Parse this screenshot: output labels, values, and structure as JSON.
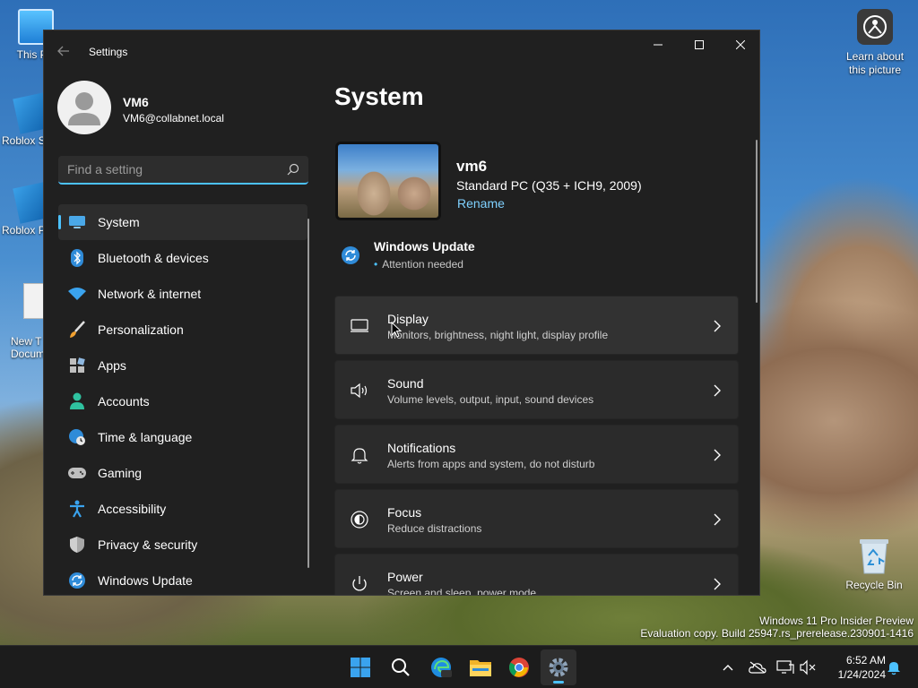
{
  "desktop": {
    "icons": [
      {
        "label": "This PC",
        "name": "this-pc"
      },
      {
        "label": "Roblox S",
        "name": "roblox-studio"
      },
      {
        "label": "Roblox P",
        "name": "roblox-player"
      },
      {
        "label": "New T\nDocum",
        "name": "new-text-document"
      }
    ],
    "learn_label": "Learn about this picture",
    "recycle_label": "Recycle Bin",
    "watermark_line1": "Windows 11 Pro Insider Preview",
    "watermark_line2": "Evaluation copy. Build 25947.rs_prerelease.230901-1416"
  },
  "window": {
    "title": "Settings"
  },
  "profile": {
    "name": "VM6",
    "email": "VM6@collabnet.local"
  },
  "search": {
    "placeholder": "Find a setting"
  },
  "nav": {
    "items": [
      {
        "label": "System",
        "icon": "monitor-icon",
        "active": true
      },
      {
        "label": "Bluetooth & devices",
        "icon": "bluetooth-icon"
      },
      {
        "label": "Network & internet",
        "icon": "wifi-icon"
      },
      {
        "label": "Personalization",
        "icon": "brush-icon"
      },
      {
        "label": "Apps",
        "icon": "apps-icon"
      },
      {
        "label": "Accounts",
        "icon": "person-icon"
      },
      {
        "label": "Time & language",
        "icon": "globe-clock-icon"
      },
      {
        "label": "Gaming",
        "icon": "gamepad-icon"
      },
      {
        "label": "Accessibility",
        "icon": "accessibility-icon"
      },
      {
        "label": "Privacy & security",
        "icon": "shield-icon"
      },
      {
        "label": "Windows Update",
        "icon": "update-icon"
      }
    ]
  },
  "main": {
    "title": "System",
    "device": {
      "name": "vm6",
      "model": "Standard PC (Q35 + ICH9, 2009)",
      "rename": "Rename"
    },
    "update": {
      "title": "Windows Update",
      "status": "Attention needed"
    },
    "cards": [
      {
        "title": "Display",
        "subtitle": "Monitors, brightness, night light, display profile",
        "icon": "display-icon"
      },
      {
        "title": "Sound",
        "subtitle": "Volume levels, output, input, sound devices",
        "icon": "speaker-icon"
      },
      {
        "title": "Notifications",
        "subtitle": "Alerts from apps and system, do not disturb",
        "icon": "bell-icon"
      },
      {
        "title": "Focus",
        "subtitle": "Reduce distractions",
        "icon": "focus-icon"
      },
      {
        "title": "Power",
        "subtitle": "Screen and sleep, power mode",
        "icon": "power-icon"
      }
    ]
  },
  "taskbar": {
    "time": "6:52 AM",
    "date": "1/24/2024",
    "apps": [
      "start-icon",
      "search-icon",
      "edge-icon",
      "file-explorer-icon",
      "chrome-icon",
      "settings-icon"
    ]
  },
  "colors": {
    "accent": "#4cc2ff",
    "window_bg": "#202020",
    "card_bg": "#2b2b2b",
    "taskbar_bg": "#1c1c1c"
  }
}
